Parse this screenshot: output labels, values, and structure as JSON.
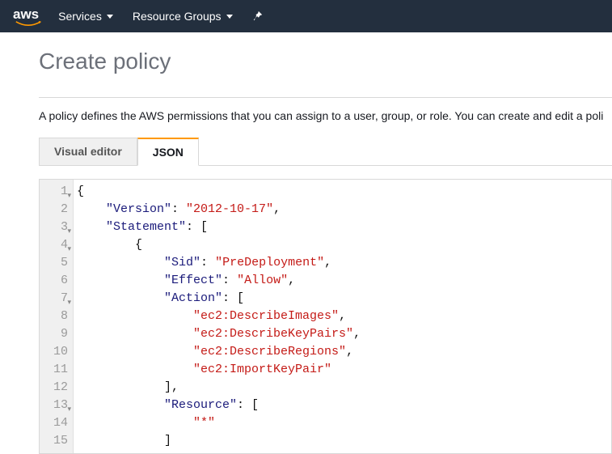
{
  "nav": {
    "logo_text": "aws",
    "services_label": "Services",
    "resource_groups_label": "Resource Groups"
  },
  "page": {
    "title": "Create policy",
    "description": "A policy defines the AWS permissions that you can assign to a user, group, or role. You can create and edit a poli"
  },
  "tabs": {
    "visual_editor": "Visual editor",
    "json": "JSON"
  },
  "editor": {
    "lines": [
      {
        "n": "1",
        "fold": true,
        "tokens": [
          {
            "t": "{",
            "c": "punc"
          }
        ]
      },
      {
        "n": "2",
        "fold": false,
        "tokens": [
          {
            "t": "    ",
            "c": "p"
          },
          {
            "t": "\"Version\"",
            "c": "key"
          },
          {
            "t": ": ",
            "c": "punc"
          },
          {
            "t": "\"2012-10-17\"",
            "c": "str"
          },
          {
            "t": ",",
            "c": "punc"
          }
        ]
      },
      {
        "n": "3",
        "fold": true,
        "tokens": [
          {
            "t": "    ",
            "c": "p"
          },
          {
            "t": "\"Statement\"",
            "c": "key"
          },
          {
            "t": ": [",
            "c": "punc"
          }
        ]
      },
      {
        "n": "4",
        "fold": true,
        "tokens": [
          {
            "t": "        {",
            "c": "punc"
          }
        ]
      },
      {
        "n": "5",
        "fold": false,
        "tokens": [
          {
            "t": "            ",
            "c": "p"
          },
          {
            "t": "\"Sid\"",
            "c": "key"
          },
          {
            "t": ": ",
            "c": "punc"
          },
          {
            "t": "\"PreDeployment\"",
            "c": "str"
          },
          {
            "t": ",",
            "c": "punc"
          }
        ]
      },
      {
        "n": "6",
        "fold": false,
        "tokens": [
          {
            "t": "            ",
            "c": "p"
          },
          {
            "t": "\"Effect\"",
            "c": "key"
          },
          {
            "t": ": ",
            "c": "punc"
          },
          {
            "t": "\"Allow\"",
            "c": "str"
          },
          {
            "t": ",",
            "c": "punc"
          }
        ]
      },
      {
        "n": "7",
        "fold": true,
        "tokens": [
          {
            "t": "            ",
            "c": "p"
          },
          {
            "t": "\"Action\"",
            "c": "key"
          },
          {
            "t": ": [",
            "c": "punc"
          }
        ]
      },
      {
        "n": "8",
        "fold": false,
        "tokens": [
          {
            "t": "                ",
            "c": "p"
          },
          {
            "t": "\"ec2:DescribeImages\"",
            "c": "str"
          },
          {
            "t": ",",
            "c": "punc"
          }
        ]
      },
      {
        "n": "9",
        "fold": false,
        "tokens": [
          {
            "t": "                ",
            "c": "p"
          },
          {
            "t": "\"ec2:DescribeKeyPairs\"",
            "c": "str"
          },
          {
            "t": ",",
            "c": "punc"
          }
        ]
      },
      {
        "n": "10",
        "fold": false,
        "tokens": [
          {
            "t": "                ",
            "c": "p"
          },
          {
            "t": "\"ec2:DescribeRegions\"",
            "c": "str"
          },
          {
            "t": ",",
            "c": "punc"
          }
        ]
      },
      {
        "n": "11",
        "fold": false,
        "tokens": [
          {
            "t": "                ",
            "c": "p"
          },
          {
            "t": "\"ec2:ImportKeyPair\"",
            "c": "str"
          }
        ]
      },
      {
        "n": "12",
        "fold": false,
        "tokens": [
          {
            "t": "            ],",
            "c": "punc"
          }
        ]
      },
      {
        "n": "13",
        "fold": true,
        "tokens": [
          {
            "t": "            ",
            "c": "p"
          },
          {
            "t": "\"Resource\"",
            "c": "key"
          },
          {
            "t": ": [",
            "c": "punc"
          }
        ]
      },
      {
        "n": "14",
        "fold": false,
        "tokens": [
          {
            "t": "                ",
            "c": "p"
          },
          {
            "t": "\"*\"",
            "c": "str"
          }
        ]
      },
      {
        "n": "15",
        "fold": false,
        "tokens": [
          {
            "t": "            ]",
            "c": "punc"
          }
        ]
      }
    ]
  }
}
